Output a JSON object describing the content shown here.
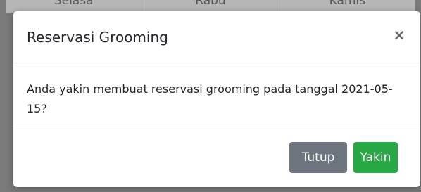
{
  "background_table": {
    "columns": [
      "Selasa",
      "Rabu",
      "Kamis"
    ]
  },
  "modal": {
    "title": "Reservasi Grooming",
    "close_glyph": "×",
    "message": "Anda yakin membuat reservasi grooming pada tanggal 2021-05-15?",
    "buttons": {
      "close_label": "Tutup",
      "confirm_label": "Yakin"
    }
  },
  "colors": {
    "overlay": "#7a7a7a",
    "secondary_button": "#6c757d",
    "success_button": "#28a745",
    "modal_background": "#ffffff"
  }
}
